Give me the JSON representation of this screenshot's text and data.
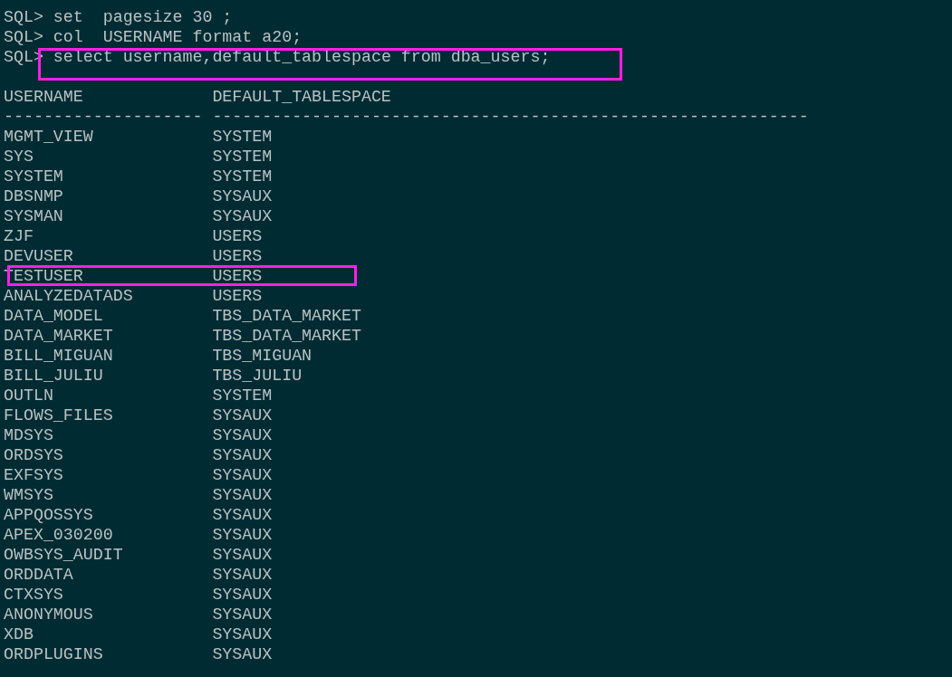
{
  "commands": [
    {
      "prompt": "SQL>",
      "text": "set  pagesize 30 ;",
      "highlighted": false
    },
    {
      "prompt": "SQL>",
      "text": "col  USERNAME format a20;",
      "highlighted": false
    },
    {
      "prompt": "SQL>",
      "text": "select username,default_tablespace from dba_users;",
      "highlighted": true
    }
  ],
  "result": {
    "columns": [
      {
        "heading": "USERNAME",
        "rule": "--------------------"
      },
      {
        "heading": "DEFAULT_TABLESPACE",
        "rule": "------------------------------------------------------------"
      }
    ],
    "rows": [
      {
        "username": "MGMT_VIEW",
        "tablespace": "SYSTEM",
        "highlighted": false
      },
      {
        "username": "SYS",
        "tablespace": "SYSTEM",
        "highlighted": false
      },
      {
        "username": "SYSTEM",
        "tablespace": "SYSTEM",
        "highlighted": false
      },
      {
        "username": "DBSNMP",
        "tablespace": "SYSAUX",
        "highlighted": false
      },
      {
        "username": "SYSMAN",
        "tablespace": "SYSAUX",
        "highlighted": false
      },
      {
        "username": "ZJF",
        "tablespace": "USERS",
        "highlighted": false
      },
      {
        "username": "DEVUSER",
        "tablespace": "USERS",
        "highlighted": false
      },
      {
        "username": "TESTUSER",
        "tablespace": "USERS",
        "highlighted": true
      },
      {
        "username": "ANALYZEDATADS",
        "tablespace": "USERS",
        "highlighted": false
      },
      {
        "username": "DATA_MODEL",
        "tablespace": "TBS_DATA_MARKET",
        "highlighted": false
      },
      {
        "username": "DATA_MARKET",
        "tablespace": "TBS_DATA_MARKET",
        "highlighted": false
      },
      {
        "username": "BILL_MIGUAN",
        "tablespace": "TBS_MIGUAN",
        "highlighted": false
      },
      {
        "username": "BILL_JULIU",
        "tablespace": "TBS_JULIU",
        "highlighted": false
      },
      {
        "username": "OUTLN",
        "tablespace": "SYSTEM",
        "highlighted": false
      },
      {
        "username": "FLOWS_FILES",
        "tablespace": "SYSAUX",
        "highlighted": false
      },
      {
        "username": "MDSYS",
        "tablespace": "SYSAUX",
        "highlighted": false
      },
      {
        "username": "ORDSYS",
        "tablespace": "SYSAUX",
        "highlighted": false
      },
      {
        "username": "EXFSYS",
        "tablespace": "SYSAUX",
        "highlighted": false
      },
      {
        "username": "WMSYS",
        "tablespace": "SYSAUX",
        "highlighted": false
      },
      {
        "username": "APPQOSSYS",
        "tablespace": "SYSAUX",
        "highlighted": false
      },
      {
        "username": "APEX_030200",
        "tablespace": "SYSAUX",
        "highlighted": false
      },
      {
        "username": "OWBSYS_AUDIT",
        "tablespace": "SYSAUX",
        "highlighted": false
      },
      {
        "username": "ORDDATA",
        "tablespace": "SYSAUX",
        "highlighted": false
      },
      {
        "username": "CTXSYS",
        "tablespace": "SYSAUX",
        "highlighted": false
      },
      {
        "username": "ANONYMOUS",
        "tablespace": "SYSAUX",
        "highlighted": false
      },
      {
        "username": "XDB",
        "tablespace": "SYSAUX",
        "highlighted": false
      },
      {
        "username": "ORDPLUGINS",
        "tablespace": "SYSAUX",
        "highlighted": false
      }
    ]
  }
}
